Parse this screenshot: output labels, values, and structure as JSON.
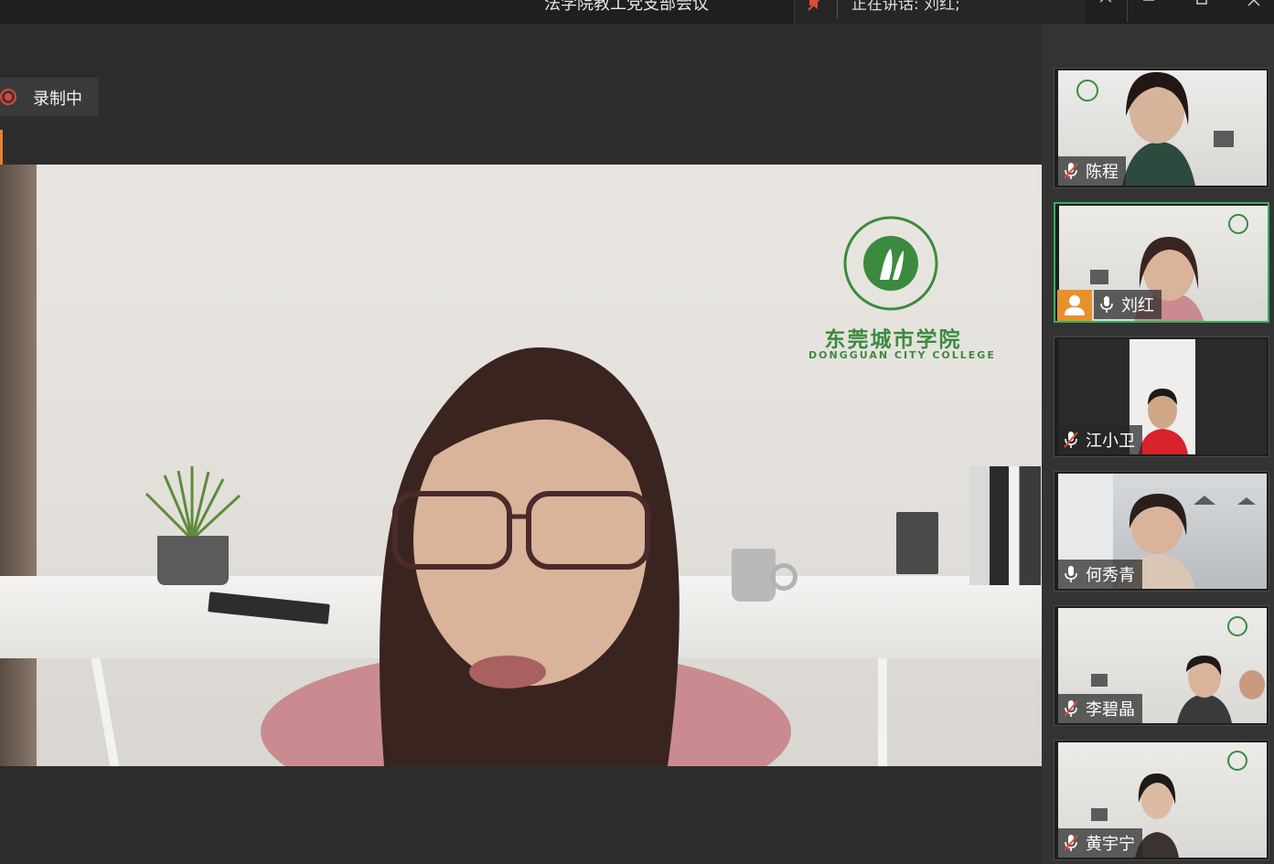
{
  "titlebar": {
    "meeting_title": "法学院教工党支部会议",
    "speaking_label": "正在讲话: 刘红;",
    "controls": [
      "minimize-icon",
      "restore-icon",
      "close-icon"
    ]
  },
  "recording": {
    "label": "录制中",
    "color": "#e0463a"
  },
  "main_video": {
    "logo_cn": "东莞城市学院",
    "logo_en": "DONGGUAN CITY COLLEGE",
    "logo_ring_text": "东莞城市学院 DONGGUAN CITY COLLEGE",
    "brand_color": "#3c8a3f"
  },
  "participants": [
    {
      "name": "陈程",
      "mic": "muted",
      "host": false,
      "active": false
    },
    {
      "name": "刘红",
      "mic": "on",
      "host": true,
      "active": true
    },
    {
      "name": "江小卫",
      "mic": "muted",
      "host": false,
      "active": false
    },
    {
      "name": "何秀青",
      "mic": "on",
      "host": false,
      "active": false
    },
    {
      "name": "李碧晶",
      "mic": "muted",
      "host": false,
      "active": false
    },
    {
      "name": "黄宇宁",
      "mic": "muted",
      "host": false,
      "active": false
    }
  ],
  "colors": {
    "active_border": "#35b05a",
    "host_badge": "#e8912c",
    "muted_mic": "#e04b3c"
  }
}
